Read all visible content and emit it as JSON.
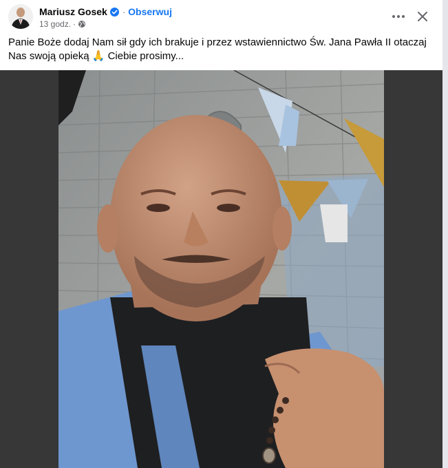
{
  "post": {
    "author": "Mariusz Gosek",
    "separator": "·",
    "follow_label": "Obserwuj",
    "time": "13 godz.",
    "meta_separator": "·",
    "audience_icon": "globe-icon",
    "verified_icon": "verified-badge-icon",
    "more_icon": "more-horizontal-icon",
    "close_icon": "close-icon",
    "text": "Panie Boże dodaj Nam sił gdy ich brakuje i przez wstawiennictwo Św. Jana Pawła II otaczaj Nas swoją opieką 🙏 Ciebie prosimy..."
  },
  "media": {
    "description_icon": "photo"
  },
  "colors": {
    "accent": "#1877f2",
    "secondary_text": "#65676b",
    "media_background": "#373737"
  }
}
